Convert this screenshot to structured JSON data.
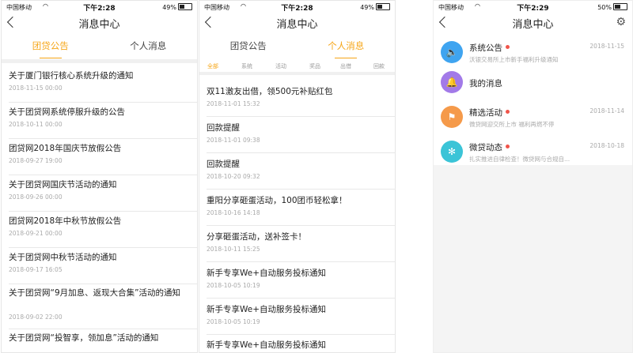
{
  "status": {
    "carrier": "中国移动",
    "battery_p1": "49%",
    "battery_p2": "49%",
    "battery_p3": "50%",
    "time_p1": "下午2:28",
    "time_p2": "下午2:28",
    "time_p3": "下午2:29"
  },
  "screen1": {
    "title": "消息中心",
    "tabs": [
      "团贷公告",
      "个人消息"
    ],
    "active_tab": 0,
    "items": [
      {
        "title": "关于厦门银行核心系统升级的通知",
        "date": "2018-11-15 00:00"
      },
      {
        "title": "关于团贷网系统停服升级的公告",
        "date": "2018-10-11 00:00"
      },
      {
        "title": "团贷网2018年国庆节放假公告",
        "date": "2018-09-27 19:00"
      },
      {
        "title": "关于团贷网国庆节活动的通知",
        "date": "2018-09-26 00:00"
      },
      {
        "title": "团贷网2018年中秋节放假公告",
        "date": "2018-09-21 00:00"
      },
      {
        "title": "关于团贷网中秋节活动的通知",
        "date": "2018-09-17 16:05"
      },
      {
        "title": "关于团贷网“9月加息、返现大合集”活动的通知",
        "date": "2018-09-02 22:00"
      },
      {
        "title": "关于团贷网“投智享，领加息”活动的通知",
        "date": ""
      }
    ]
  },
  "screen2": {
    "title": "消息中心",
    "tabs": [
      "团贷公告",
      "个人消息"
    ],
    "active_tab": 1,
    "categories": [
      "全部",
      "系统",
      "活动",
      "奖品",
      "出借",
      "回款"
    ],
    "items": [
      {
        "title": "双11激友出借，领500元补贴红包",
        "date": "2018-11-01 15:32"
      },
      {
        "title": "回款提醒",
        "date": "2018-11-01 09:38"
      },
      {
        "title": "回款提醒",
        "date": "2018-10-20 09:32"
      },
      {
        "title": "重阳分享砸蛋活动，100团币轻松拿！",
        "date": "2018-10-16 14:18"
      },
      {
        "title": "分享砸蛋活动，送补签卡！",
        "date": "2018-10-11 15:25"
      },
      {
        "title": "新手专享We+自动服务投标通知",
        "date": "2018-10-05 10:19"
      },
      {
        "title": "新手专享We+自动服务投标通知",
        "date": "2018-10-05 10:19"
      },
      {
        "title": "新手专享We+自动服务投标通知",
        "date": ""
      }
    ]
  },
  "screen3": {
    "title": "消息中心",
    "items": [
      {
        "name": "系统公告",
        "sub": "沃银交易所上市新手福利升级通知",
        "date": "2018-11-15",
        "dot": true,
        "icon": "speaker-icon",
        "glyph": "🔈",
        "color": "#3fa4f0"
      },
      {
        "name": "我的消息",
        "sub": "",
        "date": "",
        "dot": false,
        "icon": "bell-icon",
        "glyph": "🔔",
        "color": "#a27ae8"
      },
      {
        "name": "精选活动",
        "sub": "微贷网迎交所上市 福利再燃不停",
        "date": "2018-11-14",
        "dot": true,
        "icon": "flag-icon",
        "glyph": "⚑",
        "color": "#f59a4a"
      },
      {
        "name": "微贷动态",
        "sub": "扎实推进自律检查！微贷网与合规自...",
        "date": "2018-10-18",
        "dot": true,
        "icon": "fan-icon",
        "glyph": "✻",
        "color": "#3bc4d7"
      }
    ]
  }
}
